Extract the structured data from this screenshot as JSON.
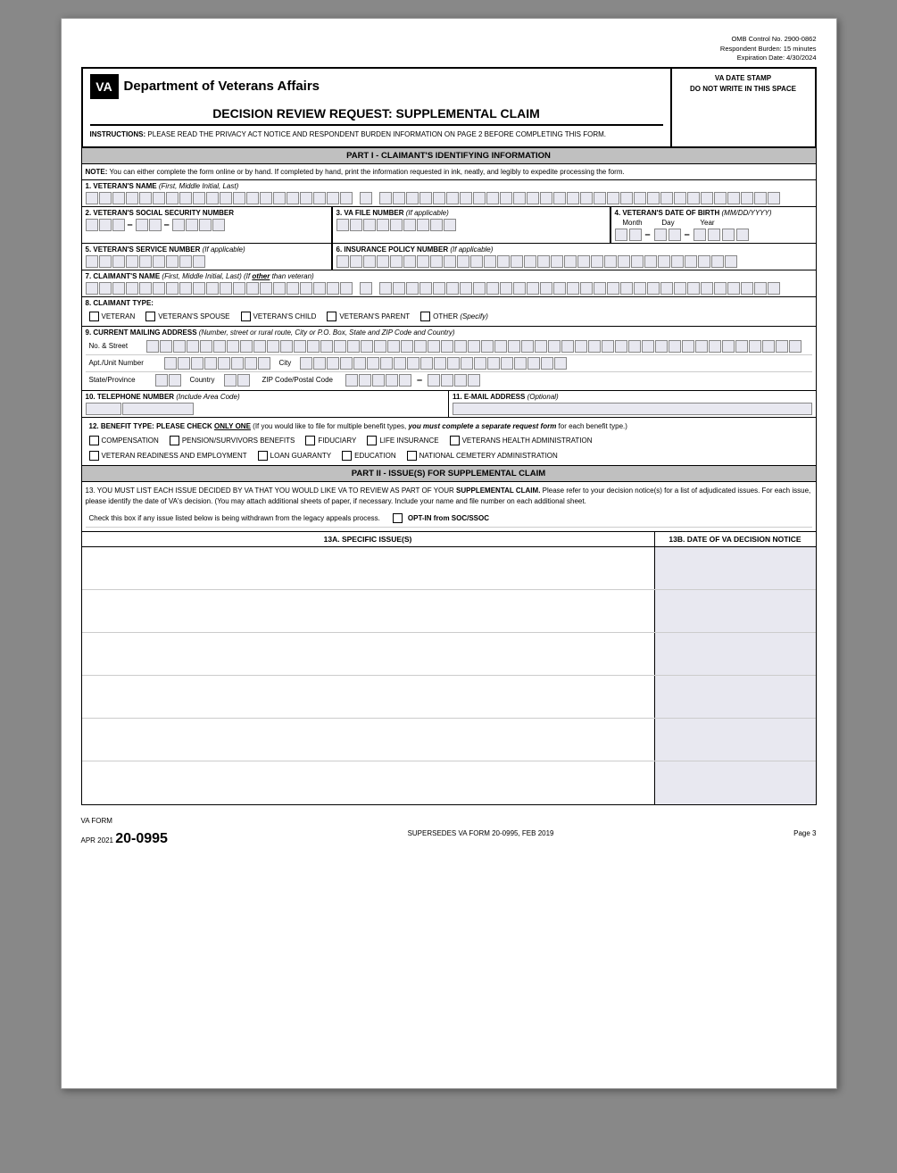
{
  "omb": {
    "control": "OMB Control No. 2900-0862",
    "burden": "Respondent Burden: 15 minutes",
    "expiration": "Expiration Date: 4/30/2024"
  },
  "header": {
    "va_stamp_label": "VA DATE STAMP",
    "va_stamp_note": "DO NOT WRITE IN THIS SPACE",
    "dept_name": "Department of Veterans Affairs",
    "form_title": "DECISION REVIEW REQUEST:  SUPPLEMENTAL CLAIM",
    "instructions": "INSTRUCTIONS:",
    "instructions_text": "  PLEASE READ THE PRIVACY ACT NOTICE AND RESPONDENT BURDEN INFORMATION ON PAGE 2 BEFORE COMPLETING THIS FORM."
  },
  "part1": {
    "title": "PART I - CLAIMANT'S IDENTIFYING INFORMATION",
    "note_label": "NOTE:",
    "note_text": "  You can either complete the form online or by hand.  If completed by hand, print the information requested in ink, neatly, and legibly to expedite processing the form.",
    "field1_label": "1. VETERAN'S NAME",
    "field1_sub": "(First, Middle Initial, Last)",
    "field2_label": "2. VETERAN'S SOCIAL SECURITY NUMBER",
    "field3_label": "3. VA FILE NUMBER",
    "field3_sub": "(If applicable)",
    "field4_label": "4. VETERAN'S DATE OF BIRTH",
    "field4_sub": "(MM/DD/YYYY)",
    "dob_month": "Month",
    "dob_day": "Day",
    "dob_year": "Year",
    "field5_label": "5. VETERAN'S SERVICE NUMBER",
    "field5_sub": "(If applicable)",
    "field6_label": "6.  INSURANCE POLICY NUMBER",
    "field6_sub": "(If applicable)",
    "field7_label": "7. CLAIMANT'S NAME",
    "field7_sub": "(First, Middle Initial, Last) (If",
    "field7_other": "other",
    "field7_end": "than veteran)",
    "field8_label": "8.  CLAIMANT TYPE:",
    "claimant_types": [
      "VETERAN",
      "VETERAN'S SPOUSE",
      "VETERAN'S CHILD",
      "VETERAN'S PARENT",
      "OTHER (Specify)"
    ],
    "field9_label": "9.  CURRENT MAILING ADDRESS",
    "field9_sub": "(Number, street or rural route, City or P.O. Box, State and ZIP Code and Country)",
    "addr_no_street": "No. & Street",
    "addr_apt": "Apt./Unit Number",
    "addr_city": "City",
    "addr_state": "State/Province",
    "addr_country": "Country",
    "addr_zip": "ZIP Code/Postal Code",
    "field10_label": "10. TELEPHONE NUMBER",
    "field10_sub": "(Include Area Code)",
    "field11_label": "11. E-MAIL ADDRESS",
    "field11_sub": "(Optional)",
    "field12_label": "12. BENEFIT TYPE:",
    "field12_bold": "PLEASE CHECK",
    "field12_underline": "ONLY ONE",
    "field12_rest": "(If you would like to file for multiple benefit types,",
    "field12_bold2": "you must complete a separate request form",
    "field12_end": "for each benefit type.)",
    "benefit_types_row1": [
      "COMPENSATION",
      "PENSION/SURVIVORS BENEFITS",
      "FIDUCIARY",
      "LIFE INSURANCE",
      "VETERANS HEALTH ADMINISTRATION"
    ],
    "benefit_types_row2": [
      "VETERAN READINESS AND EMPLOYMENT",
      "LOAN GUARANTY",
      "EDUCATION",
      "NATIONAL CEMETERY ADMINISTRATION"
    ]
  },
  "part2": {
    "title": "PART II - ISSUE(S) FOR SUPPLEMENTAL CLAIM",
    "instruction_pre": "13.  YOU MUST LIST EACH ISSUE DECIDED BY VA THAT YOU WOULD LIKE VA TO REVIEW AS PART OF YOUR",
    "instruction_bold": "SUPPLEMENTAL CLAIM.",
    "instruction_post": " Please refer to your decision notice(s) for a list of adjudicated issues.  For each issue, please identify the date of VA's decision. (You may attach additional sheets of paper, if necessary. Include your name and file number on each additional sheet.",
    "opt_in_pre": "Check this box if any issue listed below is being withdrawn from the legacy appeals process.",
    "opt_in_label": "OPT-IN from SOC/SSOC",
    "col_a_label": "13A.  SPECIFIC ISSUE(S)",
    "col_b_label": "13B.  DATE OF VA DECISION NOTICE",
    "issue_rows": [
      {
        "issue": "",
        "date": ""
      },
      {
        "issue": "",
        "date": ""
      },
      {
        "issue": "",
        "date": ""
      },
      {
        "issue": "",
        "date": ""
      },
      {
        "issue": "",
        "date": ""
      },
      {
        "issue": "",
        "date": ""
      }
    ]
  },
  "footer": {
    "va_form": "VA FORM",
    "date": "APR 2021",
    "form_number": "20-0995",
    "supersedes": "SUPERSEDES VA FORM 20-0995, FEB 2019",
    "page": "Page 3"
  }
}
